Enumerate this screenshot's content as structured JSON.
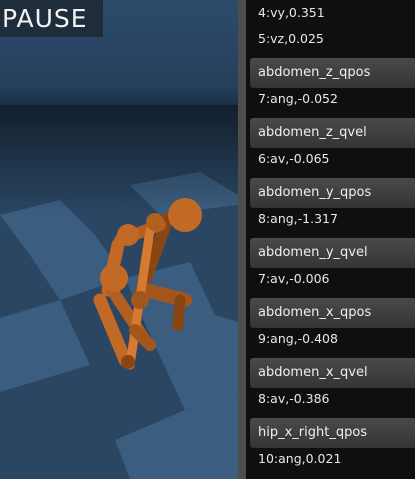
{
  "viewport": {
    "pause_label": "PAUSE",
    "colors": {
      "floor_light": "#3b5e80",
      "floor_dark": "#2a4663",
      "body": "#c26a25",
      "body_shadow": "#8a4612"
    }
  },
  "sensor_panel": {
    "entries": [
      {
        "value": "4:vy,0.351"
      },
      {
        "value": "5:vz,0.025"
      },
      {
        "title": "abdomen_z_qpos",
        "value": "7:ang,-0.052"
      },
      {
        "title": "abdomen_z_qvel",
        "value": "6:av,-0.065"
      },
      {
        "title": "abdomen_y_qpos",
        "value": "8:ang,-1.317"
      },
      {
        "title": "abdomen_y_qvel",
        "value": "7:av,-0.006"
      },
      {
        "title": "abdomen_x_qpos",
        "value": "9:ang,-0.408"
      },
      {
        "title": "abdomen_x_qvel",
        "value": "8:av,-0.386"
      },
      {
        "title": "hip_x_right_qpos",
        "value": "10:ang,0.021"
      }
    ]
  }
}
